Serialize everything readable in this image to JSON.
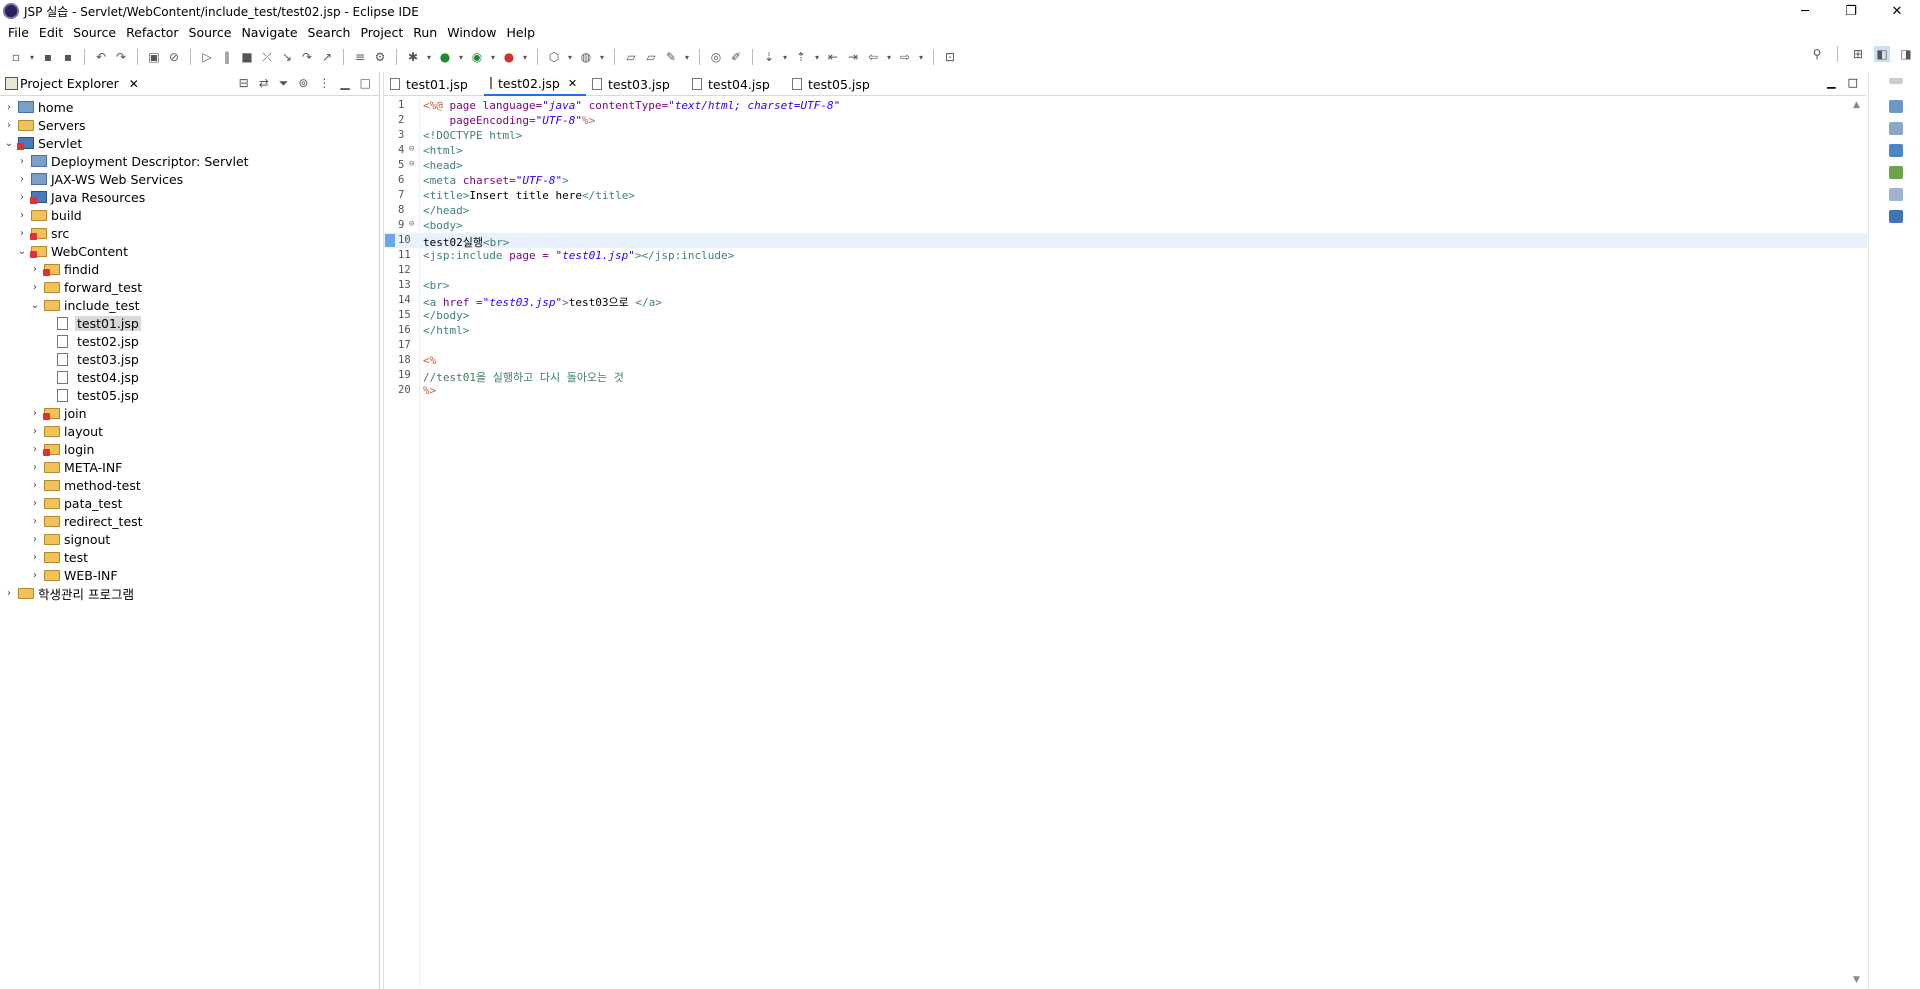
{
  "window": {
    "title": "JSP 실습 - Servlet/WebContent/include_test/test02.jsp - Eclipse IDE",
    "controls": [
      "─",
      "❐",
      "✕"
    ]
  },
  "menu": [
    "File",
    "Edit",
    "Source",
    "Refactor",
    "Source",
    "Navigate",
    "Search",
    "Project",
    "Run",
    "Window",
    "Help"
  ],
  "explorer": {
    "title": "Project Explorer",
    "tree": [
      {
        "label": "home",
        "depth": 0,
        "twisty": "›",
        "icon": "gen"
      },
      {
        "label": "Servers",
        "depth": 0,
        "twisty": "›",
        "icon": "folder"
      },
      {
        "label": "Servlet",
        "depth": 0,
        "twisty": "⌄",
        "icon": "proj"
      },
      {
        "label": "Deployment Descriptor: Servlet",
        "depth": 1,
        "twisty": "›",
        "icon": "gen"
      },
      {
        "label": "JAX-WS Web Services",
        "depth": 1,
        "twisty": "›",
        "icon": "gen"
      },
      {
        "label": "Java Resources",
        "depth": 1,
        "twisty": "›",
        "icon": "proj"
      },
      {
        "label": "build",
        "depth": 1,
        "twisty": "›",
        "icon": "folder"
      },
      {
        "label": "src",
        "depth": 1,
        "twisty": "›",
        "icon": "pfolder"
      },
      {
        "label": "WebContent",
        "depth": 1,
        "twisty": "⌄",
        "icon": "pfolder"
      },
      {
        "label": "findid",
        "depth": 2,
        "twisty": "›",
        "icon": "pfolder"
      },
      {
        "label": "forward_test",
        "depth": 2,
        "twisty": "›",
        "icon": "folder"
      },
      {
        "label": "include_test",
        "depth": 2,
        "twisty": "⌄",
        "icon": "folder"
      },
      {
        "label": "test01.jsp",
        "depth": 3,
        "twisty": "",
        "icon": "file",
        "selected": true
      },
      {
        "label": "test02.jsp",
        "depth": 3,
        "twisty": "",
        "icon": "file"
      },
      {
        "label": "test03.jsp",
        "depth": 3,
        "twisty": "",
        "icon": "file"
      },
      {
        "label": "test04.jsp",
        "depth": 3,
        "twisty": "",
        "icon": "file"
      },
      {
        "label": "test05.jsp",
        "depth": 3,
        "twisty": "",
        "icon": "file"
      },
      {
        "label": "join",
        "depth": 2,
        "twisty": "›",
        "icon": "pfolder"
      },
      {
        "label": "layout",
        "depth": 2,
        "twisty": "›",
        "icon": "folder"
      },
      {
        "label": "login",
        "depth": 2,
        "twisty": "›",
        "icon": "pfolder"
      },
      {
        "label": "META-INF",
        "depth": 2,
        "twisty": "›",
        "icon": "folder"
      },
      {
        "label": "method-test",
        "depth": 2,
        "twisty": "›",
        "icon": "folder"
      },
      {
        "label": "pata_test",
        "depth": 2,
        "twisty": "›",
        "icon": "folder"
      },
      {
        "label": "redirect_test",
        "depth": 2,
        "twisty": "›",
        "icon": "folder"
      },
      {
        "label": " signout",
        "depth": 2,
        "twisty": "›",
        "icon": "folder"
      },
      {
        "label": "test",
        "depth": 2,
        "twisty": "›",
        "icon": "folder"
      },
      {
        "label": "WEB-INF",
        "depth": 2,
        "twisty": "›",
        "icon": "folder"
      },
      {
        "label": "학생관리 프로그램",
        "depth": 0,
        "twisty": "›",
        "icon": "folder"
      }
    ]
  },
  "editor": {
    "tabs": [
      {
        "label": "test01.jsp",
        "active": false
      },
      {
        "label": "test02.jsp",
        "active": true
      },
      {
        "label": "test03.jsp",
        "active": false
      },
      {
        "label": "test04.jsp",
        "active": false
      },
      {
        "label": "test05.jsp",
        "active": false
      }
    ],
    "current_line": 10,
    "lines": [
      {
        "n": "1",
        "fold": "",
        "parts": [
          [
            "jsp",
            "<%@ "
          ],
          [
            "attr",
            "page "
          ],
          [
            "attr",
            "language="
          ],
          [
            "val",
            "\"java\""
          ],
          [
            "attr",
            " contentType="
          ],
          [
            "val",
            "\"text/html; charset=UTF-8\""
          ]
        ]
      },
      {
        "n": "2",
        "fold": "",
        "parts": [
          [
            "attr",
            "    pageEncoding="
          ],
          [
            "val",
            "\"UTF-8\""
          ],
          [
            "jsp",
            "%>"
          ]
        ]
      },
      {
        "n": "3",
        "fold": "",
        "parts": [
          [
            "tag",
            "<!DOCTYPE html>"
          ]
        ]
      },
      {
        "n": "4",
        "fold": "⊖",
        "parts": [
          [
            "tag",
            "<html>"
          ]
        ]
      },
      {
        "n": "5",
        "fold": "⊖",
        "parts": [
          [
            "tag",
            "<head>"
          ]
        ]
      },
      {
        "n": "6",
        "fold": "",
        "parts": [
          [
            "tag",
            "<meta "
          ],
          [
            "attr",
            "charset="
          ],
          [
            "val",
            "\"UTF-8\""
          ],
          [
            "tag",
            ">"
          ]
        ]
      },
      {
        "n": "7",
        "fold": "",
        "parts": [
          [
            "tag",
            "<title>"
          ],
          [
            "txt",
            "Insert title here"
          ],
          [
            "tag",
            "</title>"
          ]
        ]
      },
      {
        "n": "8",
        "fold": "",
        "parts": [
          [
            "tag",
            "</head>"
          ]
        ]
      },
      {
        "n": "9",
        "fold": "⊖",
        "parts": [
          [
            "tag",
            "<body>"
          ]
        ]
      },
      {
        "n": "10",
        "fold": "",
        "parts": [
          [
            "txt",
            "test02실행"
          ],
          [
            "tag",
            "<br>"
          ]
        ]
      },
      {
        "n": "11",
        "fold": "",
        "parts": [
          [
            "tag",
            "<jsp:include "
          ],
          [
            "attr",
            "page = "
          ],
          [
            "val",
            "\"test01.jsp\""
          ],
          [
            "tag",
            "></jsp:include>"
          ]
        ]
      },
      {
        "n": "12",
        "fold": "",
        "parts": []
      },
      {
        "n": "13",
        "fold": "",
        "parts": [
          [
            "tag",
            "<br>"
          ]
        ]
      },
      {
        "n": "14",
        "fold": "",
        "parts": [
          [
            "tag",
            "<a "
          ],
          [
            "attr",
            "href ="
          ],
          [
            "val",
            "\"test03.jsp\""
          ],
          [
            "tag",
            ">"
          ],
          [
            "txt",
            "test03으로 "
          ],
          [
            "tag",
            "</a>"
          ]
        ]
      },
      {
        "n": "15",
        "fold": "",
        "parts": [
          [
            "tag",
            "</body>"
          ]
        ]
      },
      {
        "n": "16",
        "fold": "",
        "parts": [
          [
            "tag",
            "</html>"
          ]
        ]
      },
      {
        "n": "17",
        "fold": "",
        "parts": []
      },
      {
        "n": "18",
        "fold": "",
        "parts": [
          [
            "jsp",
            "<%"
          ]
        ]
      },
      {
        "n": "19",
        "fold": "",
        "parts": [
          [
            "com",
            "//test01을 실행하고 다시 돌아오는 것"
          ]
        ]
      },
      {
        "n": "20",
        "fold": "",
        "parts": [
          [
            "jsp",
            "%>"
          ]
        ]
      }
    ]
  },
  "colors": {
    "active_tab_underline": "#1a73e8",
    "current_line_bg": "#e8f2fe",
    "tree_selection_bg": "#d9d9d9"
  }
}
